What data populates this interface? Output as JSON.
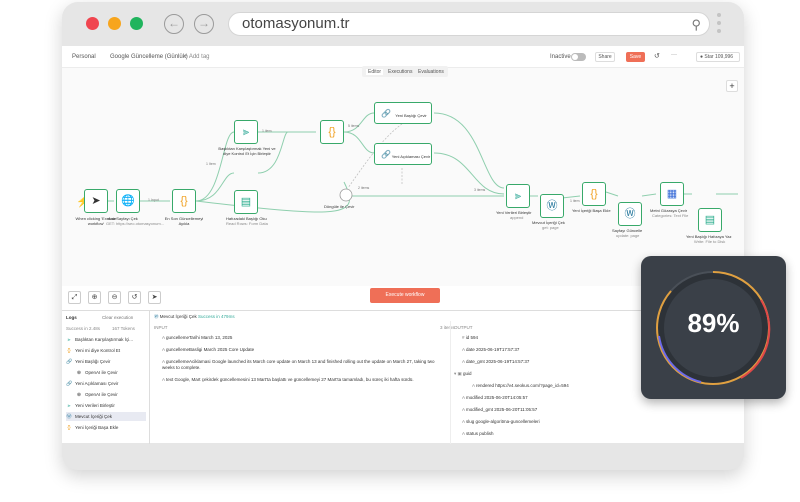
{
  "browser": {
    "url": "otomasyonum.tr"
  },
  "topbar": {
    "owner": "Personal",
    "workflow_title": "Google Güncelleme (Günlük)",
    "add_tag": "+ Add tag",
    "inactive_label": "Inactive",
    "share": "Share",
    "save": "Save",
    "more": "···",
    "star": "Star",
    "star_count": "109,996"
  },
  "tabs": [
    "Editor",
    "Executions",
    "Evaluations"
  ],
  "nodes": {
    "trigger": "When clicking 'Execute workflow'",
    "http": "Ana Sayfayı Çek",
    "http_sub": "GET: https://seo.otomasyonum...",
    "code1": "En Son Güncellemeyi Ayıkla",
    "compare": "Başlıktan Karşılaştırmak Yeni ve diye Kontrol Et İçin Birleştir",
    "compare_sub": "append",
    "code2": "",
    "sheet": "Hafızadaki Başlığı Oku",
    "sheet_sub": "Read Rows: Form Data",
    "openai1": "Yeni Başlığı Çevir",
    "openai2": "Yeni Açıklaması Çevir",
    "loop": "Döngüle ile Çevir",
    "merge2": "Yeni Verileri Birleştir",
    "merge2_sub": "append",
    "wp1": "Mevcut İçeriği Çek",
    "wp1_sub": "get: page",
    "code3": "Yeni İçeriği Başa Ekle",
    "wp2": "Sayfayı Güncelle",
    "wp2_sub": "update: page",
    "docs": "Metni Gözasya Çevir",
    "docs_sub": "Categories: Text File",
    "sheet2": "Yeni Başlığı Hafızaya Yaz",
    "sheet2_sub": "Write: File to Disk"
  },
  "edge_labels": {
    "input": "1 Input",
    "items": "1 Item",
    "items_g": "1 item",
    "items5": "5 items",
    "item": "1 item",
    "items2": "2 items",
    "items3": "3 items"
  },
  "toolbar": {
    "fit": "⤢",
    "zoom_in": "⊕",
    "zoom_out": "⊖",
    "reset": "↺",
    "pointer": "➤"
  },
  "execute": "Execute workflow",
  "logs": {
    "title": "Logs",
    "clear": "Clear execution",
    "success": "Success in 2.48s",
    "tokens": "167 Tokens",
    "items": [
      "Başlıktan Karşılaştırmak İçi...",
      "Yeni mi diye Kontrol Et",
      "Yeni Başlığı Çevir",
      "OpenAI ile Çevir",
      "Yeni Açıklaması Çevir",
      "OpenAI ile Çevir",
      "Yeni Verileri Birleştir",
      "Mevcut İçeriği Çek",
      "Yeni İçeriği Başa Ekle"
    ]
  },
  "node_panel": {
    "title": "Mevcut İçeriği Çek",
    "status": "Success in 479ms"
  },
  "input": {
    "header": "INPUT",
    "items_count": "3 items",
    "rows": [
      {
        "k": "guncellemeTarihi",
        "v": "March 13, 2025"
      },
      {
        "k": "guncellemeBasligi",
        "v": "March 2025 Core Update"
      },
      {
        "k": "guncellemeAciklamasi",
        "v": "Google launched its March core update on March 13 and finished rolling out the update on March 27, taking two weeks to complete."
      },
      {
        "k": "text",
        "v": "Google, Mart çekirdek güncellemesini 13 Mart'ta başlattı ve güncellemeyi 27 Mart'ta tamamladı, bu süreç iki hafta sürdü."
      }
    ]
  },
  "output": {
    "header": "OUTPUT",
    "rows": [
      {
        "k": "id",
        "v": "594"
      },
      {
        "k": "date",
        "v": "2025-06-19T17:57:37"
      },
      {
        "k": "date_gmt",
        "v": "2025-06-19T14:57:37"
      },
      {
        "k": "guid",
        "v": ""
      },
      {
        "k": "rendered",
        "v": "https://v4.seokus.com/?page_id=594"
      },
      {
        "k": "modified",
        "v": "2025-06-20T14:05:57"
      },
      {
        "k": "modified_gmt",
        "v": "2025-06-20T11:05:57"
      },
      {
        "k": "slug",
        "v": "google-algoritma-guncellemeleri"
      },
      {
        "k": "status",
        "v": "publish"
      }
    ]
  },
  "badge": {
    "percent": "89%"
  },
  "colors": {
    "accent": "#ef6f57",
    "node_border": "#38a96a",
    "badge_bg": "#3a4048"
  }
}
